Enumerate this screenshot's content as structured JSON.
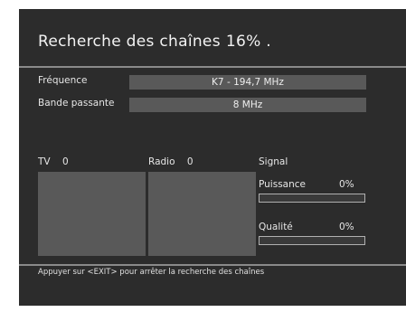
{
  "header": {
    "title": "Recherche des chaînes",
    "progress_text": "16% ."
  },
  "fields": {
    "frequency_label": "Fréquence",
    "frequency_value": "K7 - 194,7 MHz",
    "bandwidth_label": "Bande passante",
    "bandwidth_value": "8 MHz"
  },
  "lists": {
    "tv_label": "TV",
    "tv_count": "0",
    "radio_label": "Radio",
    "radio_count": "0"
  },
  "signal": {
    "title": "Signal",
    "power_label": "Puissance",
    "power_value": "0%",
    "power_level": 0,
    "quality_label": "Qualité",
    "quality_value": "0%",
    "quality_level": 0
  },
  "footer": {
    "hint": "Appuyer sur <EXIT> pour arrêter la recherche des chaînes"
  },
  "colors": {
    "screen_bg": "#2c2c2c",
    "panel_bg": "#595959",
    "rule": "#8a8a8a",
    "text": "#ececec"
  }
}
